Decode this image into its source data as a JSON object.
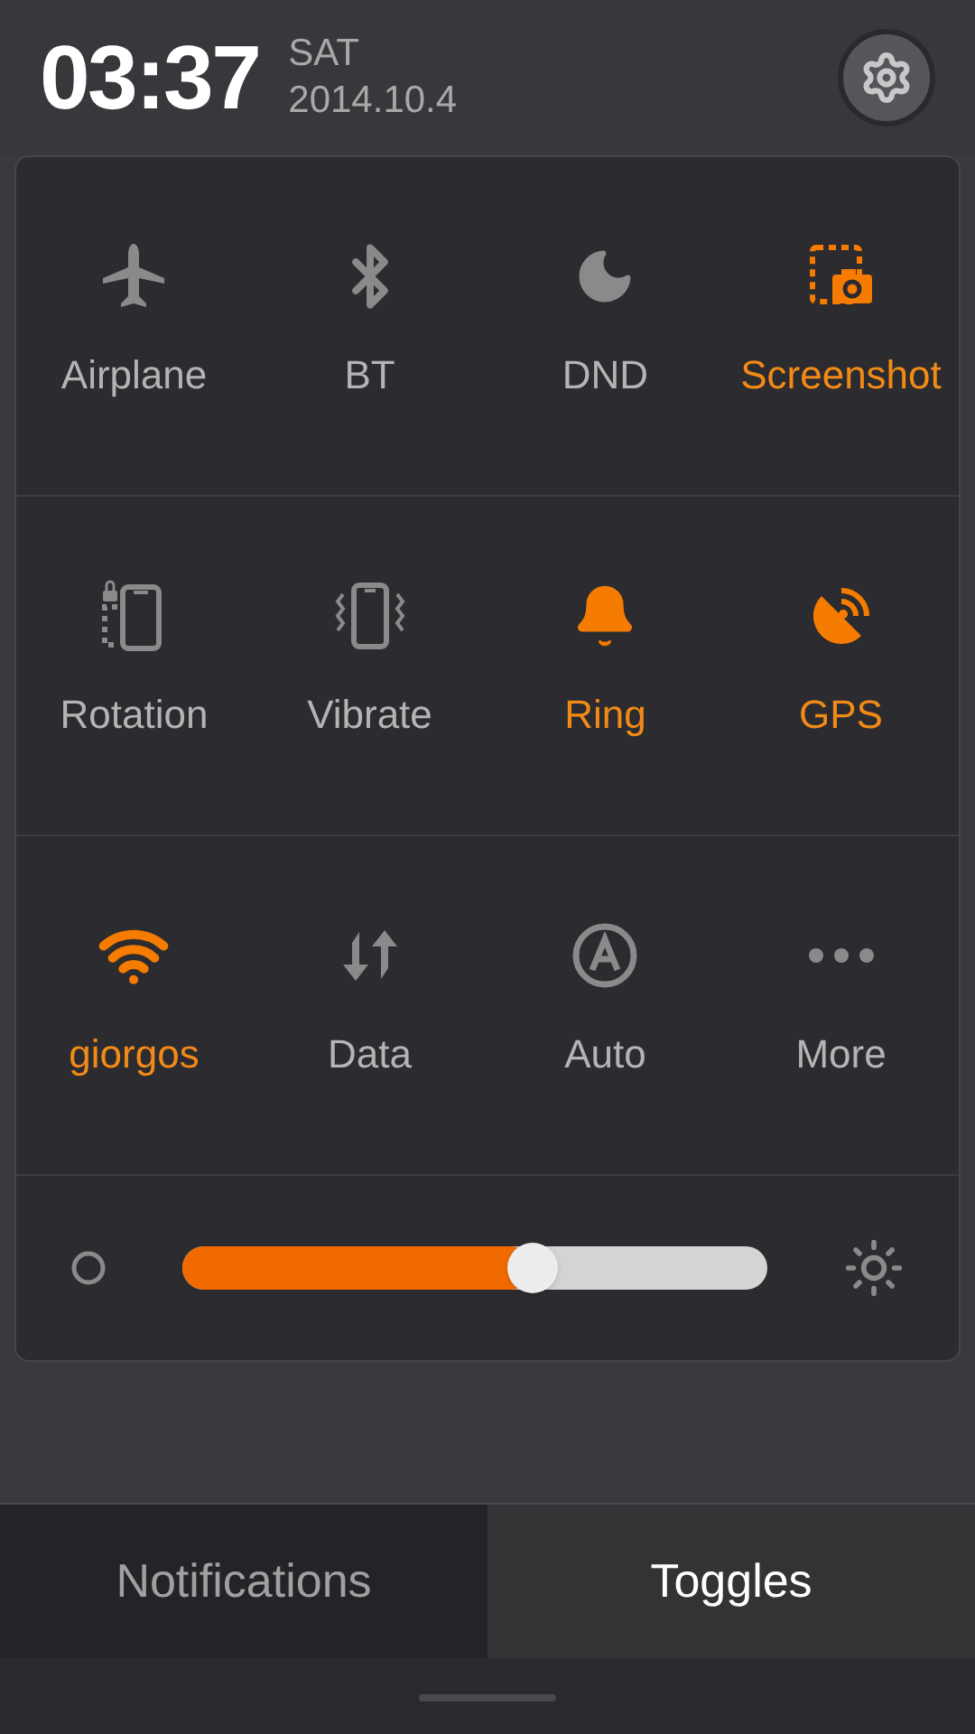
{
  "header": {
    "time": "03:37",
    "weekday": "SAT",
    "date": "2014.10.4"
  },
  "toggles": [
    {
      "label": "Airplane",
      "on": false
    },
    {
      "label": "BT",
      "on": false
    },
    {
      "label": "DND",
      "on": false
    },
    {
      "label": "Screenshot",
      "on": true
    },
    {
      "label": "Rotation",
      "on": false
    },
    {
      "label": "Vibrate",
      "on": false
    },
    {
      "label": "Ring",
      "on": true
    },
    {
      "label": "GPS",
      "on": true
    },
    {
      "label": "giorgos",
      "on": true
    },
    {
      "label": "Data",
      "on": false
    },
    {
      "label": "Auto",
      "on": false
    },
    {
      "label": "More",
      "on": false
    }
  ],
  "brightness": {
    "level": 0.6
  },
  "tabs": [
    {
      "label": "Notifications",
      "selected": false
    },
    {
      "label": "Toggles",
      "selected": true
    }
  ]
}
